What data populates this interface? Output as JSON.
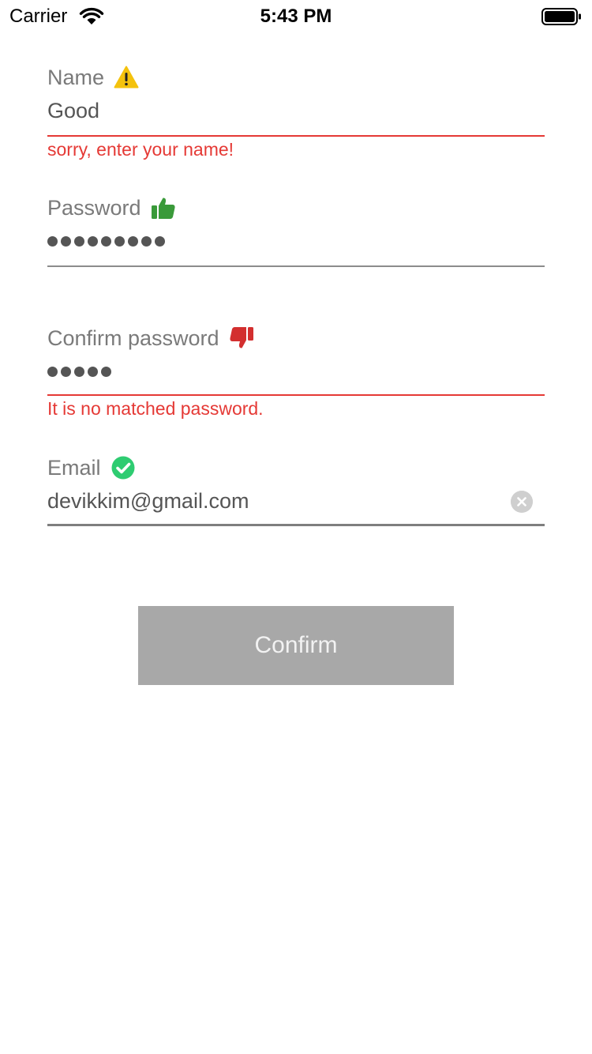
{
  "status_bar": {
    "carrier": "Carrier",
    "time": "5:43 PM",
    "wifi_icon": "wifi-icon",
    "battery_icon": "battery-icon"
  },
  "form": {
    "name": {
      "label": "Name",
      "status_icon": "warning-icon",
      "value": "Good",
      "error": "sorry, enter your name!"
    },
    "password": {
      "label": "Password",
      "status_icon": "thumbs-up-icon",
      "masked_length": 9
    },
    "confirm_password": {
      "label": "Confirm password",
      "status_icon": "thumbs-down-icon",
      "masked_length": 5,
      "error": "It is no matched password."
    },
    "email": {
      "label": "Email",
      "status_icon": "check-circle-icon",
      "value": "devikkim@gmail.com",
      "clear_icon": "clear-icon"
    }
  },
  "confirm_button": {
    "label": "Confirm"
  },
  "colors": {
    "error": "#e53935",
    "success": "#2ecc71",
    "thumbs_up": "#3a9a3a",
    "thumbs_down": "#d32f2f",
    "warning": "#f4c20d",
    "button_bg": "#a8a8a8",
    "label": "#7a7a7a",
    "value": "#555555"
  }
}
